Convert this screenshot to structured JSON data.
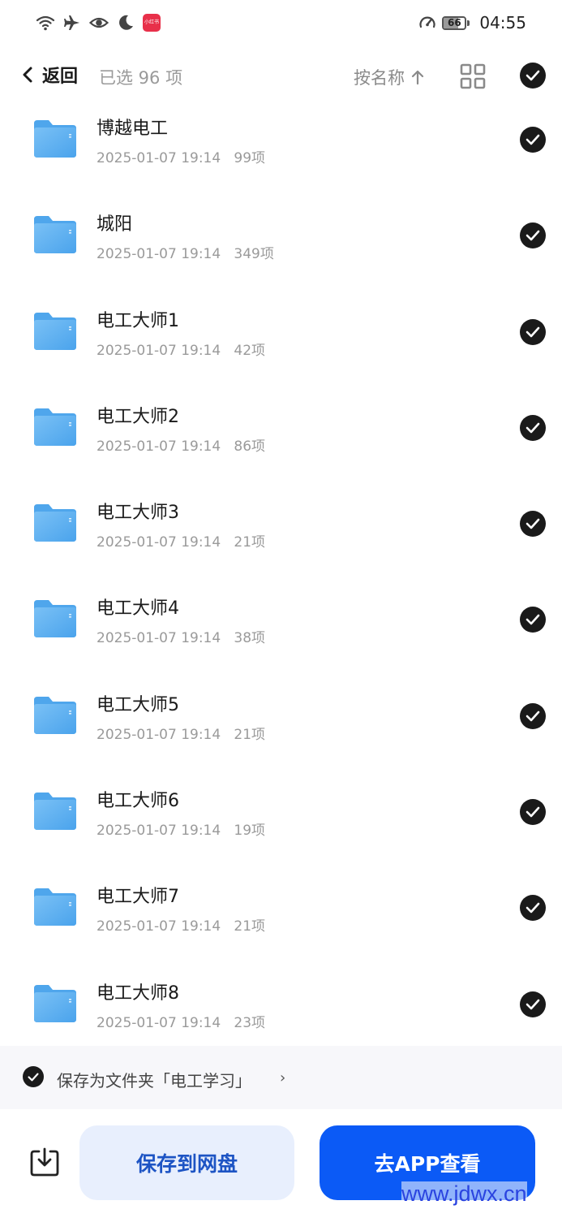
{
  "status_bar": {
    "time": "04:55",
    "battery_level": "66",
    "battery_fraction": 0.66,
    "left_icons": [
      "wifi-icon",
      "airplane-icon",
      "eye-icon",
      "moon-icon",
      "app-notification-icon"
    ],
    "right_icons": [
      "speedometer-icon",
      "battery-icon"
    ]
  },
  "header": {
    "back_label": "返回",
    "selected_count": "已选 96 项",
    "sort_label": "按名称",
    "sort_icon": "arrow-up-icon",
    "view_icon": "grid-view-icon",
    "select_all_icon": "check-circle-icon"
  },
  "files": [
    {
      "name": "博越电工",
      "date": "2025-01-07 19:14",
      "count": "99项"
    },
    {
      "name": "城阳",
      "date": "2025-01-07 19:14",
      "count": "349项"
    },
    {
      "name": "电工大师1",
      "date": "2025-01-07 19:14",
      "count": "42项"
    },
    {
      "name": "电工大师2",
      "date": "2025-01-07 19:14",
      "count": "86项"
    },
    {
      "name": "电工大师3",
      "date": "2025-01-07 19:14",
      "count": "21项"
    },
    {
      "name": "电工大师4",
      "date": "2025-01-07 19:14",
      "count": "38项"
    },
    {
      "name": "电工大师5",
      "date": "2025-01-07 19:14",
      "count": "21项"
    },
    {
      "name": "电工大师6",
      "date": "2025-01-07 19:14",
      "count": "19项"
    },
    {
      "name": "电工大师7",
      "date": "2025-01-07 19:14",
      "count": "21项"
    },
    {
      "name": "电工大师8",
      "date": "2025-01-07 19:14",
      "count": "23项"
    }
  ],
  "save_as": {
    "label": "保存为文件夹「电工学习」",
    "chevron": "›"
  },
  "bottom": {
    "save_button": "保存到网盘",
    "open_app_button": "去APP查看"
  },
  "watermark": "www.jdwx.cn",
  "colors": {
    "primary": "#0b5af6",
    "secondary_bg": "#e8effd",
    "secondary_text": "#1d54c4",
    "folder": "#5fb0f0",
    "muted_text": "#9a9a9a"
  }
}
